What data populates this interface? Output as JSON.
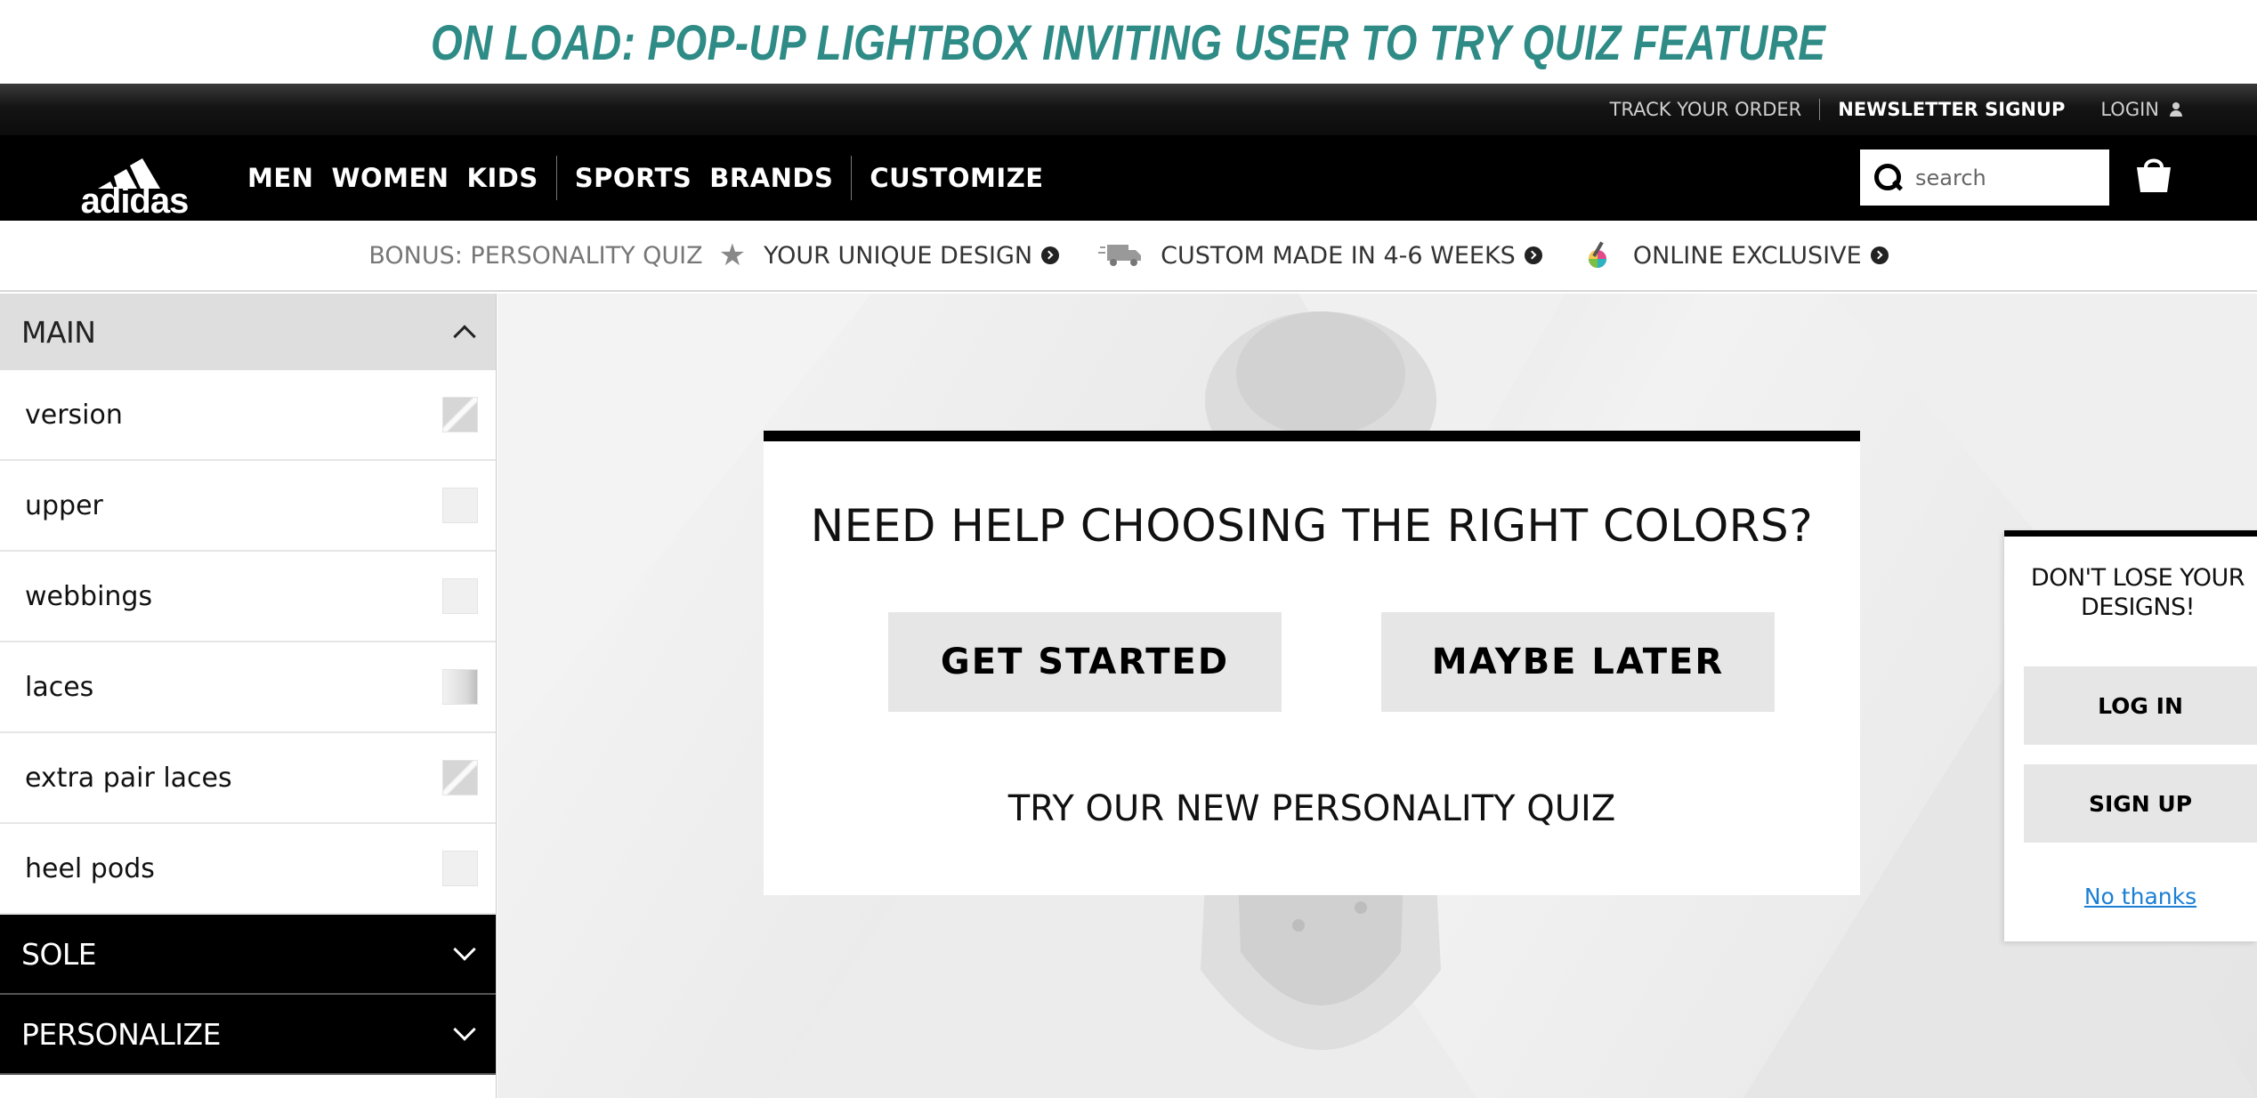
{
  "annotation": {
    "text": "ON LOAD: POP-UP LIGHTBOX INVITING USER TO TRY QUIZ FEATURE"
  },
  "utility": {
    "track_order": "TRACK YOUR ORDER",
    "newsletter": "NEWSLETTER SIGNUP",
    "login": "LOGIN"
  },
  "brand": {
    "logo_text": "adidas"
  },
  "nav": {
    "men": "MEN",
    "women": "WOMEN",
    "kids": "KIDS",
    "sports": "SPORTS",
    "brands": "BRANDS",
    "customize": "CUSTOMIZE"
  },
  "search": {
    "placeholder": "search"
  },
  "features": {
    "bonus": "BONUS: PERSONALITY QUIZ",
    "unique": "YOUR UNIQUE DESIGN",
    "custom": "CUSTOM MADE IN 4-6 WEEKS",
    "exclusive": "ONLINE EXCLUSIVE"
  },
  "sidebar": {
    "main": "MAIN",
    "items": [
      {
        "label": "version"
      },
      {
        "label": "upper"
      },
      {
        "label": "webbings"
      },
      {
        "label": "laces"
      },
      {
        "label": "extra pair laces"
      },
      {
        "label": "heel pods"
      }
    ],
    "sole": "SOLE",
    "personalize": "PERSONALIZE"
  },
  "popup": {
    "title": "NEED HELP CHOOSING THE RIGHT COLORS?",
    "get_started": "GET STARTED",
    "maybe_later": "MAYBE LATER",
    "subtitle": "TRY OUR NEW PERSONALITY QUIZ"
  },
  "save_panel": {
    "title": "DON'T LOSE YOUR DESIGNS!",
    "log_in": "LOG IN",
    "sign_up": "SIGN UP",
    "no_thanks": "No thanks"
  },
  "colors": {
    "annotation": "#2e8b86",
    "nav_bg": "#000000",
    "link": "#1a7fd4",
    "button_bg": "#e6e6e6"
  }
}
